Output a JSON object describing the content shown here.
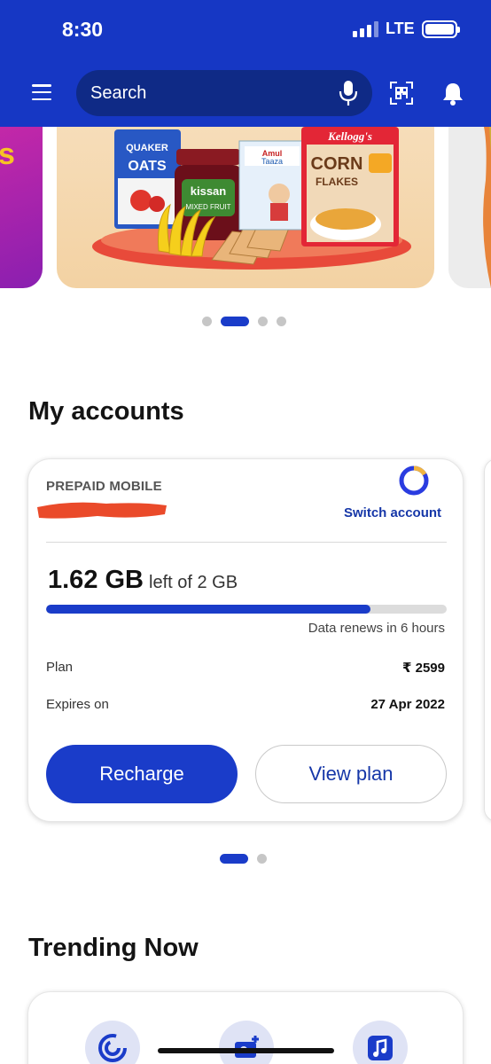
{
  "status_bar": {
    "time": "8:30",
    "network": "LTE"
  },
  "header": {
    "search_placeholder": "Search"
  },
  "banner": {
    "product_labels": [
      "QUAKER",
      "OATS",
      "kissan",
      "MIXED FRUIT",
      "Amul",
      "Taaza",
      "Kellogg's",
      "CORN",
      "FLAKES"
    ]
  },
  "carousel_1": {
    "dot_count": 4,
    "active_index": 1
  },
  "accounts": {
    "title": "My accounts",
    "card": {
      "type_label": "PREPAID MOBILE",
      "switch_label": "Switch account",
      "data_left": "1.62 GB",
      "data_total": "left of 2 GB",
      "usage_fraction": 0.81,
      "renews_text": "Data renews in 6 hours",
      "plan_label": "Plan",
      "plan_value": "₹ 2599",
      "expires_label": "Expires on",
      "expires_value": "27 Apr 2022",
      "recharge_label": "Recharge",
      "view_plan_label": "View plan"
    },
    "carousel": {
      "dot_count": 2,
      "active_index": 0
    }
  },
  "trending": {
    "title": "Trending Now"
  },
  "colors": {
    "brand": "#1637c4",
    "accent": "#1a3cc9",
    "redaction": "#ea4a2a"
  }
}
